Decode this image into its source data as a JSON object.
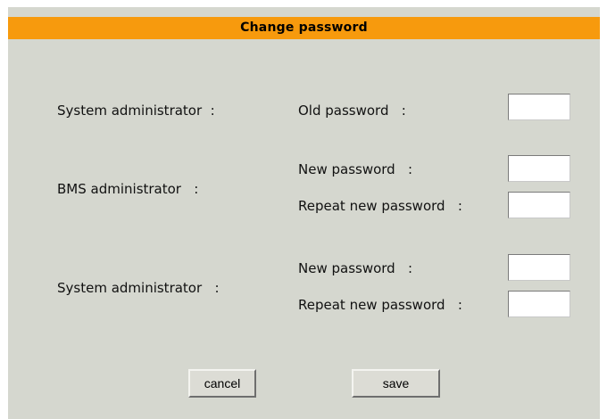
{
  "dialog": {
    "title": "Change password"
  },
  "sections": [
    {
      "label": "System administrator  :",
      "fields": [
        {
          "label": "Old password   :",
          "value": ""
        }
      ]
    },
    {
      "label": "BMS administrator   :",
      "fields": [
        {
          "label": "New password   :",
          "value": ""
        },
        {
          "label": "Repeat new password   :",
          "value": ""
        }
      ]
    },
    {
      "label": "System administrator   :",
      "fields": [
        {
          "label": "New password   :",
          "value": ""
        },
        {
          "label": "Repeat new password   :",
          "value": ""
        }
      ]
    }
  ],
  "buttons": {
    "cancel": "cancel",
    "save": "save"
  }
}
